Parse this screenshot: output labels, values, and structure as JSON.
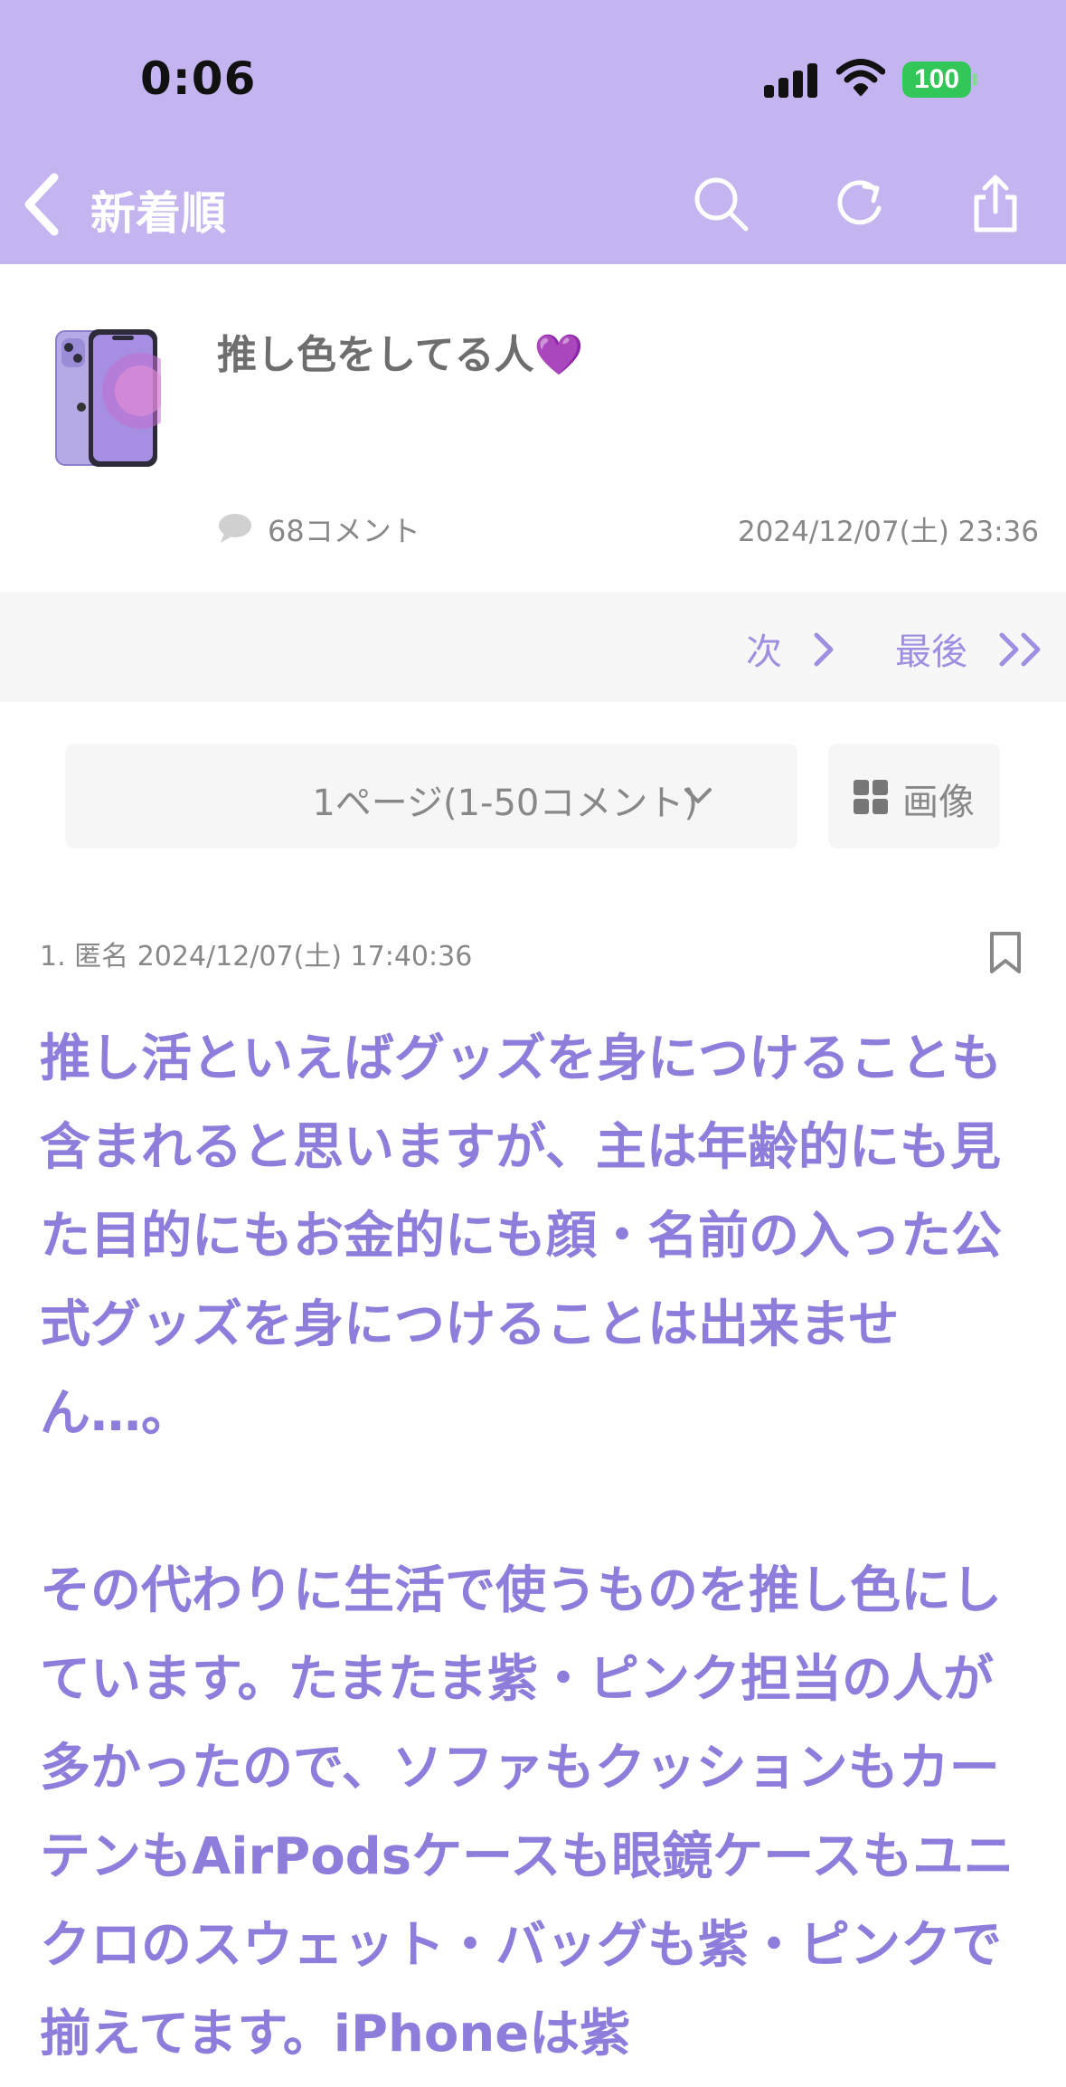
{
  "status_bar": {
    "time": "0:06",
    "battery_level": "100",
    "icons": [
      "signal-icon",
      "wifi-icon",
      "battery-icon"
    ]
  },
  "nav": {
    "back_icon": "chevron-left-icon",
    "title": "新着順",
    "actions": [
      "search-icon",
      "refresh-icon",
      "share-icon"
    ]
  },
  "topic": {
    "title": "推し色をしてる人💜",
    "comment_count": "68コメント",
    "date": "2024/12/07(土) 23:36",
    "thumbnail_icon": "purple-iphone-thumbnail"
  },
  "pager": {
    "next_label": "次",
    "last_label": "最後"
  },
  "page_select": {
    "value": "1ページ(1-50コメント)",
    "image_button_label": "画像"
  },
  "post": {
    "meta": "1. 匿名 2024/12/07(土) 17:40:36",
    "paragraph1": "推し活といえばグッズを身につけることも含まれると思いますが、主は年齢的にも見た目的にもお金的にも顔・名前の入った公式グッズを身につけることは出来ません…。",
    "paragraph2": "その代わりに生活で使うものを推し色にしています。たまたま紫・ピンク担当の人が多かったので、ソファもクッションもカーテンもAirPodsケースも眼鏡ケースもユニクロのスウェット・バッグも紫・ピンクで揃えてます。iPhoneは紫"
  },
  "colors": {
    "header_bg": "#c4b5f1",
    "accent_text": "#8f7ddb",
    "link_text": "#a08fe0"
  }
}
